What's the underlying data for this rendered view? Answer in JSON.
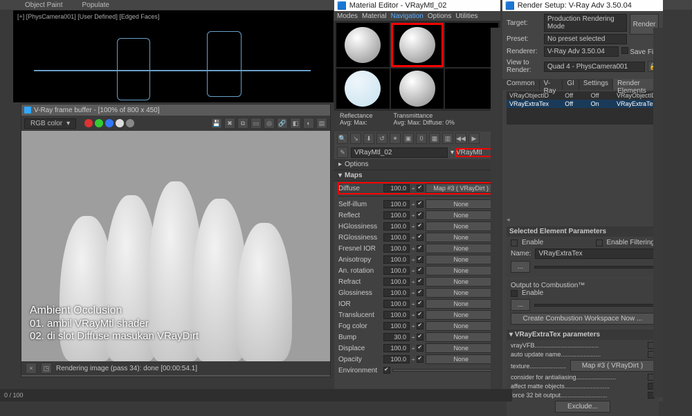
{
  "topbar": {
    "items": [
      "Object Paint",
      "Populate"
    ]
  },
  "viewport": {
    "label": "[+] [PhysCamera001] [User Defined] [Edged Faces]"
  },
  "vfb": {
    "title": "V-Ray frame buffer - [100% of 800 x 450]",
    "channel": "RGB color",
    "status": "Rendering image (pass 34): done [00:00:54.1]"
  },
  "overlay": {
    "h": "Ambient Occlusion",
    "l1": "01. ambil VRayMtl shader",
    "l2": "02. di slot Diffuse masukan VRayDirt"
  },
  "mat": {
    "title": "Material Editor - VRayMtl_02",
    "menu": [
      "Modes",
      "Material",
      "Navigation",
      "Options",
      "Utilities"
    ],
    "hist": {
      "refl_label": "Reflectance",
      "refl_avg": "Avg:",
      "refl_max": "Max:",
      "trans_label": "Transmittance",
      "trans_avg": "Avg:",
      "trans_max": "Max:",
      "diff": "Diffuse:",
      "diff_v": "0%"
    },
    "name": "VRayMtl_02",
    "type": "VRayMtl",
    "roll_options": "Options",
    "roll_maps": "Maps",
    "maps": [
      {
        "lbl": "Diffuse",
        "val": "100.0",
        "on": true,
        "map": "Map #3  ( VRayDirt )",
        "hi": true
      },
      {
        "lbl": "",
        "val": "",
        "on": false,
        "map": "",
        "spacer": true
      },
      {
        "lbl": "Self-illum",
        "val": "100.0",
        "on": true,
        "map": "None"
      },
      {
        "lbl": "Reflect",
        "val": "100.0",
        "on": true,
        "map": "None"
      },
      {
        "lbl": "HGlossiness",
        "val": "100.0",
        "on": true,
        "map": "None"
      },
      {
        "lbl": "RGlossiness",
        "val": "100.0",
        "on": true,
        "map": "None"
      },
      {
        "lbl": "Fresnel IOR",
        "val": "100.0",
        "on": true,
        "map": "None"
      },
      {
        "lbl": "Anisotropy",
        "val": "100.0",
        "on": true,
        "map": "None"
      },
      {
        "lbl": "An. rotation",
        "val": "100.0",
        "on": true,
        "map": "None"
      },
      {
        "lbl": "Refract",
        "val": "100.0",
        "on": true,
        "map": "None"
      },
      {
        "lbl": "Glossiness",
        "val": "100.0",
        "on": true,
        "map": "None"
      },
      {
        "lbl": "IOR",
        "val": "100.0",
        "on": true,
        "map": "None"
      },
      {
        "lbl": "Translucent",
        "val": "100.0",
        "on": true,
        "map": "None"
      },
      {
        "lbl": "Fog color",
        "val": "100.0",
        "on": true,
        "map": "None"
      },
      {
        "lbl": "Bump",
        "val": "30.0",
        "on": true,
        "map": "None"
      },
      {
        "lbl": "Displace",
        "val": "100.0",
        "on": true,
        "map": "None"
      },
      {
        "lbl": "Opacity",
        "val": "100.0",
        "on": true,
        "map": "None"
      },
      {
        "lbl": "Environment",
        "val": "",
        "on": true,
        "map": ""
      }
    ]
  },
  "rs": {
    "title": "Render Setup: V-Ray Adv 3.50.04",
    "target_l": "Target:",
    "target": "Production Rendering Mode",
    "preset_l": "Preset:",
    "preset": "No preset selected",
    "renderer_l": "Renderer:",
    "renderer": "V-Ray Adv 3.50.04",
    "view_l": "View to Render:",
    "view": "Quad 4 - PhysCamera001",
    "render_btn": "Render",
    "save": "Save File",
    "tabs": [
      "Common",
      "V-Ray",
      "GI",
      "Settings",
      "Render Elements"
    ],
    "list_head": [
      "",
      "",
      "",
      ""
    ],
    "list": [
      {
        "n": "VRayObjectID",
        "a": "Off",
        "b": "Off",
        "c": "VRayObjectID"
      },
      {
        "n": "VRayExtraTex",
        "a": "Off",
        "b": "On",
        "c": "VRayExtraTex",
        "sel": true
      }
    ],
    "sel_panel": {
      "head": "Selected Element Parameters",
      "enable": "Enable",
      "filter": "Enable Filtering",
      "name_l": "Name:",
      "name": "VRayExtraTex",
      "dots": "..."
    },
    "comb": {
      "head": "Output to Combustion™",
      "enable": "Enable",
      "btn": "Create Combustion Workspace Now ..."
    },
    "extra": {
      "head": "VRayExtraTex parameters",
      "rows": [
        "vrayVFB.....................................",
        "auto update name.......................",
        "texture.....................",
        "consider for antialiasing.......................",
        "affect matte objects..........................",
        "force 32 bit output..........................."
      ],
      "tex_map": "Map #3  ( VRayDirt )",
      "exclude": "Exclude..."
    }
  },
  "timeline": {
    "frames": "0 / 100"
  }
}
